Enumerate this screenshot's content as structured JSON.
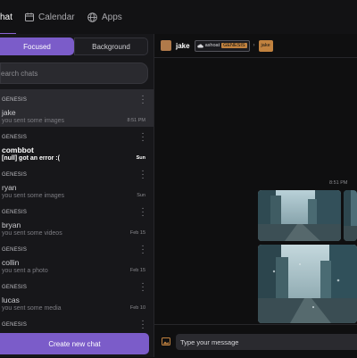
{
  "nav": {
    "tabs": [
      {
        "label": "hat",
        "icon": "chat-icon"
      },
      {
        "label": "Calendar",
        "icon": "calendar-icon"
      },
      {
        "label": "Apps",
        "icon": "globe-icon"
      }
    ],
    "accent": "#8a63d2"
  },
  "sidebar": {
    "filters": {
      "focused": "Focused",
      "background": "Background"
    },
    "search": {
      "placeholder": "earch chats"
    },
    "chats": [
      {
        "tag": "GENESIS",
        "name": "jake",
        "preview": "you sent some images",
        "time": "8:51 PM",
        "selected": true,
        "unread": false
      },
      {
        "tag": "GENESIS",
        "name": "combbot",
        "preview": "[null] got an error :(",
        "time": "Sun",
        "selected": false,
        "unread": true
      },
      {
        "tag": "GENESIS",
        "name": "ryan",
        "preview": "you sent some images",
        "time": "Sun",
        "selected": false,
        "unread": false
      },
      {
        "tag": "GENESIS",
        "name": "bryan",
        "preview": "you sent some videos",
        "time": "Feb 15",
        "selected": false,
        "unread": false
      },
      {
        "tag": "GENESIS",
        "name": "collin",
        "preview": "you sent a photo",
        "time": "Feb 15",
        "selected": false,
        "unread": false
      },
      {
        "tag": "GENESIS",
        "name": "lucas",
        "preview": "you sent some media",
        "time": "Feb 10",
        "selected": false,
        "unread": false
      },
      {
        "tag": "GENESIS",
        "name": "",
        "preview": "",
        "time": "",
        "selected": false,
        "unread": false
      }
    ],
    "create_label": "Create new chat",
    "accent": "#7b5cc9"
  },
  "conversation": {
    "header": {
      "name": "jake",
      "breadcrumb_user": "ashoat",
      "breadcrumb_community": "GENESIS",
      "breadcrumb_chat": "jake"
    },
    "timestamp": "8:51 PM",
    "composer": {
      "placeholder": "Type your message"
    }
  }
}
